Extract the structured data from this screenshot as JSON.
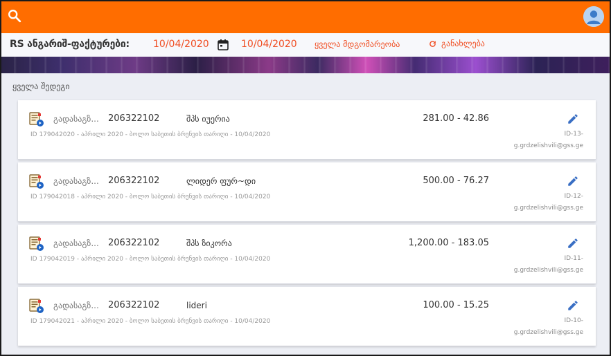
{
  "header": {
    "search_icon": "search-icon",
    "avatar_icon": "account-circle-icon"
  },
  "filters": {
    "title": "RS ანგარიშ-ფაქტურები:",
    "date_from": "10/04/2020",
    "date_to": "10/04/2020",
    "status": "ყველა მდგომარეობა",
    "refresh_label": "განახლება"
  },
  "list": {
    "section_label": "ყველა შედეგი",
    "items": [
      {
        "type": "გადასაგზ...",
        "tax_id": "206322102",
        "company": "შპს იუერია",
        "amount": "281.00 - 42.86",
        "meta": "ID 179042020 - აპრილი 2020 - ბოლო საბეთის ბრუნვის თარიღი - 10/04/2020",
        "ref_id": "ID-13-",
        "email": "g.grdzelishvili@gss.ge"
      },
      {
        "type": "გადასაგზ...",
        "tax_id": "206322102",
        "company": "ლიდერ ფურ~დი",
        "amount": "500.00 - 76.27",
        "meta": "ID 179042018 - აპრილი 2020 - ბოლო საბეთის ბრუნვის თარიღი - 10/04/2020",
        "ref_id": "ID-12-",
        "email": "g.grdzelishvili@gss.ge"
      },
      {
        "type": "გადასაგზ...",
        "tax_id": "206322102",
        "company": "შპს ზიკორა",
        "amount": "1,200.00 - 183.05",
        "meta": "ID 179042019 - აპრილი 2020 - ბოლო საბეთის ბრუნვის თარიღი - 10/04/2020",
        "ref_id": "ID-11-",
        "email": "g.grdzelishvili@gss.ge"
      },
      {
        "type": "გადასაგზ...",
        "tax_id": "206322102",
        "company": "lideri",
        "amount": "100.00 - 15.25",
        "meta": "ID 179042021 - აპრილი 2020 - ბოლო საბეთის ბრუნვის თარიღი - 10/04/2020",
        "ref_id": "ID-10-",
        "email": "g.grdzelishvili@gss.ge"
      }
    ]
  },
  "colors": {
    "topbar": "#ff6d00",
    "accent_text": "#f04e23",
    "edit_icon": "#3a6fc4"
  }
}
